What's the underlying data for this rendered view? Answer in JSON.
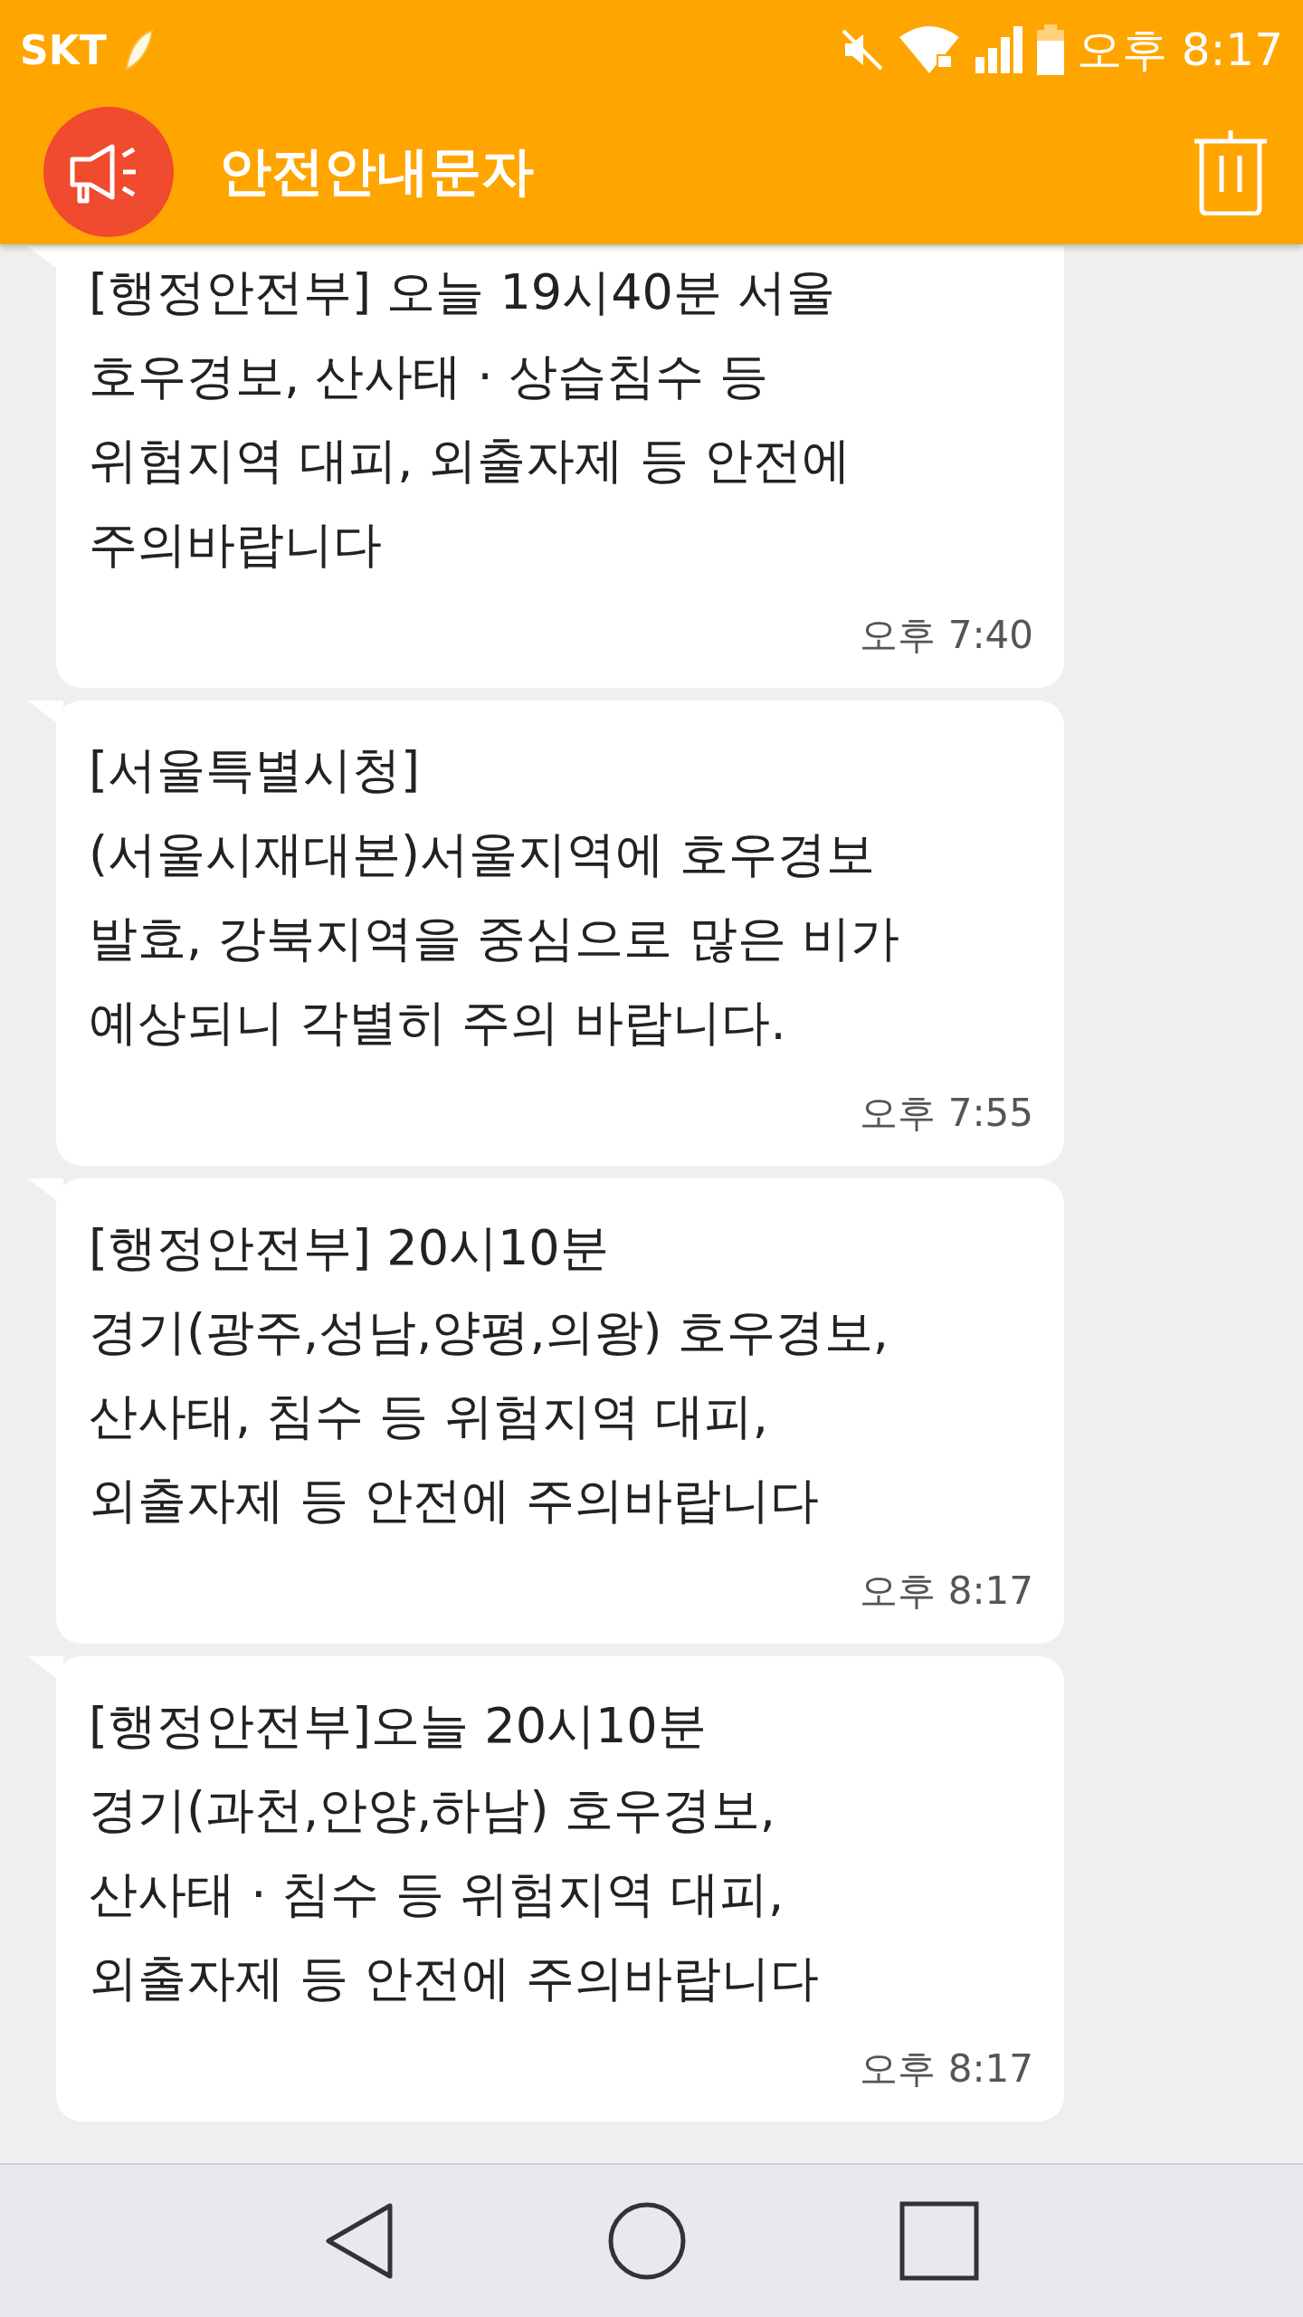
{
  "status_bar": {
    "carrier": "SKT",
    "time": "오후 8:17"
  },
  "header": {
    "title": "안전안내문자"
  },
  "messages": [
    {
      "lines": [
        "[행정안전부] 오늘 19시40분 서울",
        "호우경보, 산사태 · 상습침수 등",
        "위험지역 대피, 외출자제 등 안전에",
        "주의바랍니다"
      ],
      "time": "오후 7:40"
    },
    {
      "lines": [
        "[서울특별시청]",
        "(서울시재대본)서울지역에 호우경보",
        "발효, 강북지역을 중심으로 많은 비가",
        "예상되니 각별히 주의 바랍니다."
      ],
      "time": "오후 7:55"
    },
    {
      "lines": [
        "[행정안전부] 20시10분",
        "경기(광주,성남,양평,의왕) 호우경보,",
        "산사태, 침수 등 위험지역 대피,",
        "외출자제 등 안전에 주의바랍니다"
      ],
      "time": "오후 8:17"
    },
    {
      "lines": [
        "[행정안전부]오늘 20시10분",
        "경기(과천,안양,하남) 호우경보,",
        "산사태 · 침수 등 위험지역 대피,",
        "외출자제 등 안전에 주의바랍니다"
      ],
      "time": "오후 8:17"
    }
  ]
}
